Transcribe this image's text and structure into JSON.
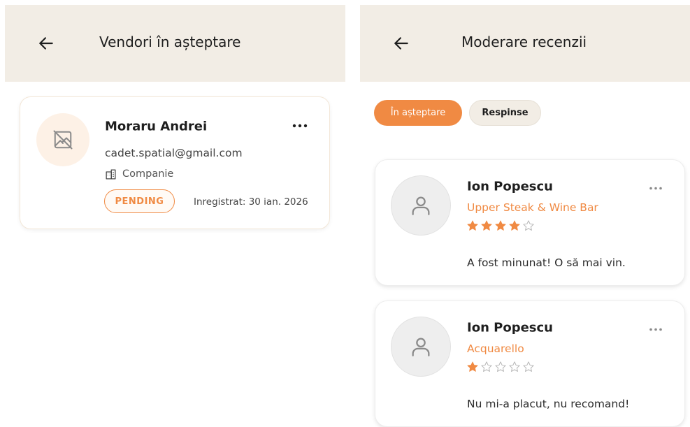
{
  "colors": {
    "accent": "#f08a43",
    "header_bg": "#f2ede5",
    "avatar_bg": "#fdf1e6",
    "text": "#1e1e1e"
  },
  "left_screen": {
    "header": {
      "title": "Vendori în așteptare",
      "back_icon": "arrow-left-icon"
    },
    "vendor_card": {
      "name": "Moraru Andrei",
      "email": "cadet.spatial@gmail.com",
      "type": "Companie",
      "type_icon": "building-icon",
      "avatar_icon": "image-off-icon",
      "status": "PENDING",
      "registered": "Inregistrat: 30 ian. 2026",
      "menu_icon": "more-horizontal-icon"
    }
  },
  "right_screen": {
    "header": {
      "title": "Moderare recenzii",
      "back_icon": "arrow-left-icon"
    },
    "filters": [
      {
        "label": "În așteptare",
        "active": true
      },
      {
        "label": "Respinse",
        "active": false
      }
    ],
    "reviews": [
      {
        "author": "Ion Popescu",
        "venue": "Upper Steak & Wine Bar",
        "rating": 4,
        "max_rating": 5,
        "text": "A fost minunat! O să mai vin.",
        "avatar_icon": "user-icon",
        "menu_icon": "more-horizontal-icon"
      },
      {
        "author": "Ion Popescu",
        "venue": "Acquarello",
        "rating": 1,
        "max_rating": 5,
        "text": "Nu mi-a placut, nu recomand!",
        "avatar_icon": "user-icon",
        "menu_icon": "more-horizontal-icon"
      }
    ]
  }
}
